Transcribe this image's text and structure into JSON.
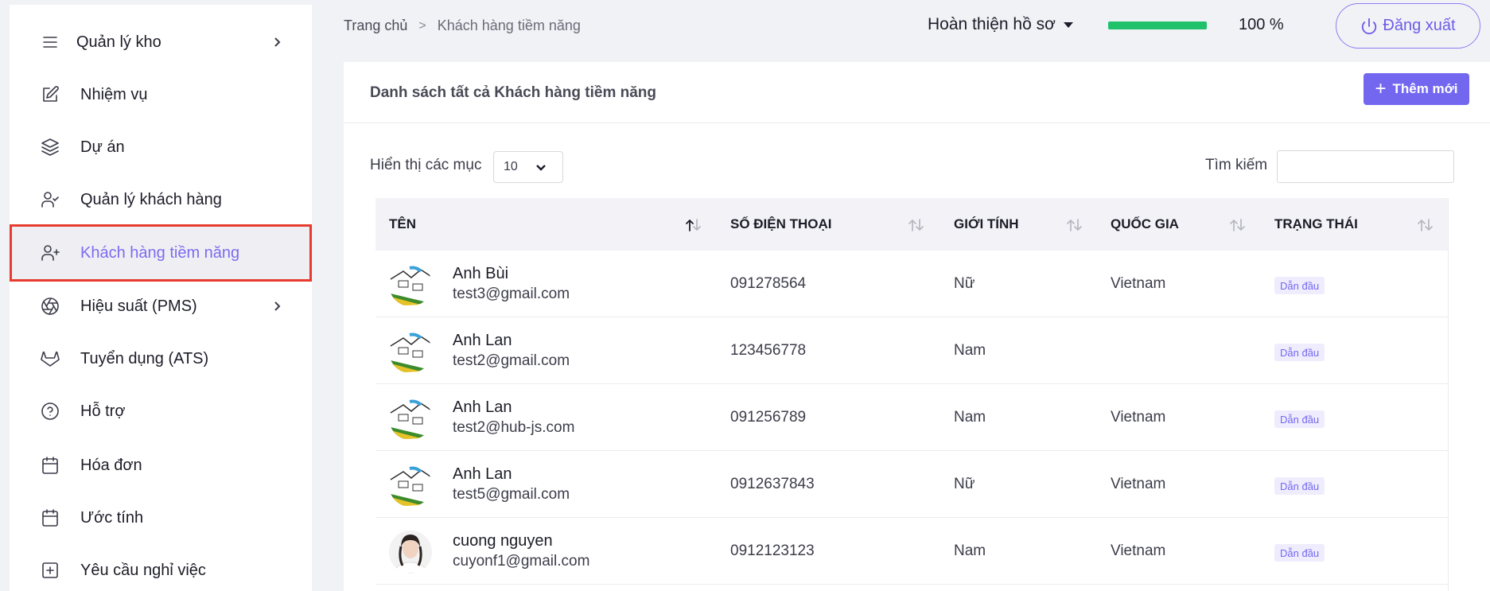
{
  "sidebar": {
    "items": [
      {
        "label": "Quản lý kho",
        "icon": "menu-icon",
        "has_submenu": true
      },
      {
        "label": "Nhiệm vụ",
        "icon": "edit-icon",
        "has_submenu": false
      },
      {
        "label": "Dự án",
        "icon": "layers-icon",
        "has_submenu": false
      },
      {
        "label": "Quản lý khách hàng",
        "icon": "user-check-icon",
        "has_submenu": false
      },
      {
        "label": "Khách hàng tiềm năng",
        "icon": "user-plus-icon",
        "has_submenu": false,
        "active": true
      },
      {
        "label": "Hiệu suất (PMS)",
        "icon": "aperture-icon",
        "has_submenu": true
      },
      {
        "label": "Tuyển dụng (ATS)",
        "icon": "gitlab-icon",
        "has_submenu": false
      },
      {
        "label": "Hỗ trợ",
        "icon": "help-circle-icon",
        "has_submenu": false
      },
      {
        "label": "Hóa đơn",
        "icon": "calendar-icon",
        "has_submenu": false
      },
      {
        "label": "Ước tính",
        "icon": "calendar-icon",
        "has_submenu": false
      },
      {
        "label": "Yêu cầu nghỉ việc",
        "icon": "plus-square-icon",
        "has_submenu": false
      }
    ]
  },
  "header": {
    "breadcrumb": {
      "home": "Trang chủ",
      "current": "Khách hàng tiềm năng"
    },
    "profile_label": "Hoàn thiện hồ sơ",
    "progress_percent": 100,
    "progress_text": "100 %",
    "logout_label": "Đăng xuất",
    "progress_color": "#1fc16b",
    "accent_color": "#7367f0"
  },
  "card": {
    "title": "Danh sách tất cả Khách hàng tiềm năng",
    "add_button_label": "Thêm mới",
    "show_label": "Hiển thị các mục",
    "page_size": "10",
    "search_label": "Tìm kiếm",
    "search_value": ""
  },
  "table": {
    "columns": [
      "TÊN",
      "SỐ ĐIỆN THOẠI",
      "GIỚI TÍNH",
      "QUỐC GIA",
      "TRẠNG THÁI"
    ],
    "rows": [
      {
        "name": "Anh Bùi",
        "email": "test3@gmail.com",
        "phone": "091278564",
        "gender": "Nữ",
        "country": "Vietnam",
        "status": "Dẫn đầu",
        "avatar": "sketch"
      },
      {
        "name": "Anh Lan",
        "email": "test2@gmail.com",
        "phone": "123456778",
        "gender": "Nam",
        "country": "",
        "status": "Dẫn đầu",
        "avatar": "sketch"
      },
      {
        "name": "Anh Lan",
        "email": "test2@hub-js.com",
        "phone": "091256789",
        "gender": "Nam",
        "country": "Vietnam",
        "status": "Dẫn đầu",
        "avatar": "sketch"
      },
      {
        "name": "Anh Lan",
        "email": "test5@gmail.com",
        "phone": "0912637843",
        "gender": "Nữ",
        "country": "Vietnam",
        "status": "Dẫn đầu",
        "avatar": "sketch"
      },
      {
        "name": "cuong nguyen",
        "email": "cuyonf1@gmail.com",
        "phone": "0912123123",
        "gender": "Nam",
        "country": "Vietnam",
        "status": "Dẫn đầu",
        "avatar": "photo"
      }
    ]
  }
}
